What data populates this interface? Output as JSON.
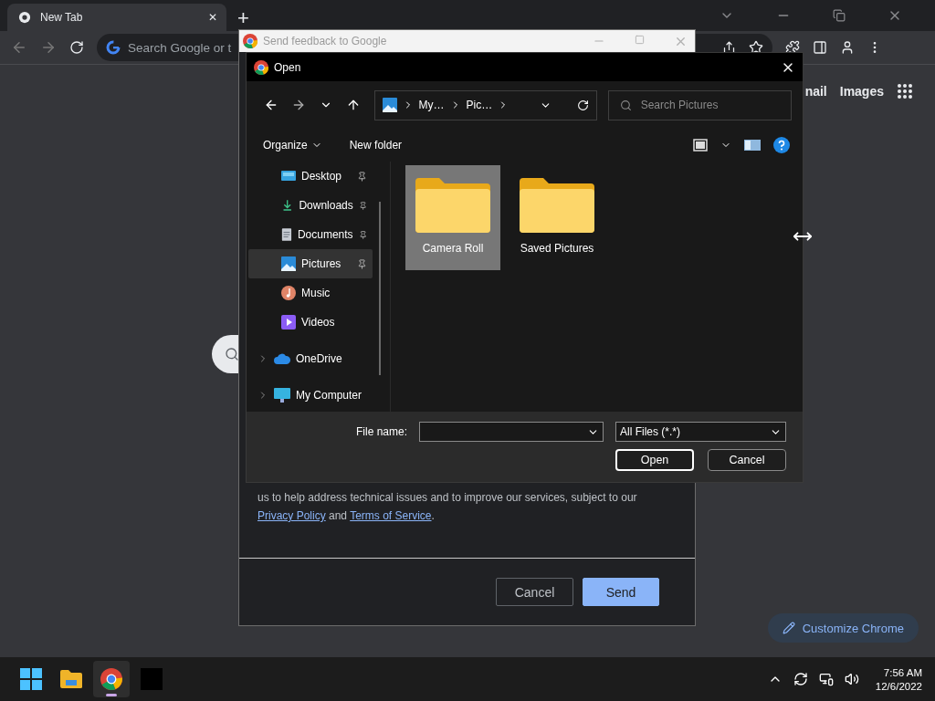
{
  "browser": {
    "tab": {
      "title": "New Tab",
      "close": "✕"
    },
    "new_tab_button": "+",
    "address_placeholder": "Search Google or t",
    "header_links": [
      "nail",
      "Images"
    ],
    "customize_button": "Customize Chrome"
  },
  "feedback_window": {
    "title": "Send feedback to Google",
    "legal": {
      "before": "us to help address technical issues and to improve our services, subject to our ",
      "link_1": "Privacy Policy",
      "middle": " and ",
      "link_2": "Terms of Service",
      "after": "."
    },
    "buttons": [
      {
        "label": "Cancel",
        "kind": "secondary"
      },
      {
        "label": "Send",
        "kind": "primary"
      }
    ]
  },
  "open_dialog": {
    "title": "Open",
    "breadcrumb": [
      "My…",
      "Pic…"
    ],
    "search_placeholder": "Search Pictures",
    "commands": [
      "Organize",
      "New folder"
    ],
    "nav_items": [
      {
        "label": "Desktop",
        "kind": "pinned",
        "selected": false
      },
      {
        "label": "Downloads",
        "kind": "pinned",
        "selected": false
      },
      {
        "label": "Documents",
        "kind": "pinned",
        "selected": false
      },
      {
        "label": "Pictures",
        "kind": "pinned",
        "selected": true
      },
      {
        "label": "Music",
        "kind": "plain",
        "selected": false
      },
      {
        "label": "Videos",
        "kind": "plain",
        "selected": false
      },
      {
        "label": "OneDrive",
        "kind": "expandable",
        "selected": false
      },
      {
        "label": "My Computer",
        "kind": "expandable",
        "selected": false
      }
    ],
    "files": [
      {
        "name": "Camera Roll",
        "selected": true
      },
      {
        "name": "Saved Pictures",
        "selected": false
      }
    ],
    "file_name_label": "File name:",
    "file_type": "All Files (*.*)",
    "buttons": [
      {
        "label": "Open",
        "kind": "default"
      },
      {
        "label": "Cancel",
        "kind": "normal"
      }
    ]
  },
  "taskbar": {
    "apps": [
      {
        "selected": false
      },
      {
        "selected": false
      },
      {
        "selected": true
      },
      {
        "selected": false
      }
    ],
    "time": "7:56 AM",
    "date": "12/6/2022"
  }
}
